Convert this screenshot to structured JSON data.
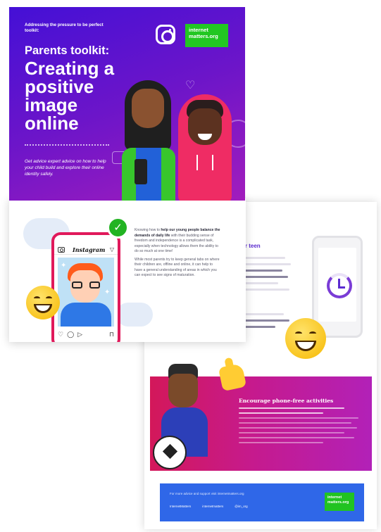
{
  "cover": {
    "kicker": "Addressing the pressure to be perfect toolkit:",
    "title_small": "Parents toolkit:",
    "title_big": "Creating a positive image online",
    "description": "Get advice expert advice on how to help your child build and explore their online identity safely.",
    "logo_text": "internet matters.org",
    "icons": [
      "instagram-icon",
      "heart-icon",
      "chat-icon"
    ]
  },
  "inner_page": {
    "app_name": "Instagram",
    "paragraph1_pre": "Knowing how to ",
    "paragraph1_bold": "help our young people balance the demands of daily life",
    "paragraph1_post": " with their budding sense of freedom and independence is a complicated task, especially when technology allows them the ability to do so much at one time!",
    "paragraph2": "While most parents try to keep general tabs on where their children are, offline and online, it can help to have a general understanding of areas in which you can expect to see signs of maturation.",
    "icons": [
      "check-icon",
      "camera-icon",
      "send-icon",
      "heart-icon",
      "comment-icon",
      "share-icon",
      "bookmark-icon"
    ]
  },
  "back_page": {
    "heading_fragment": "ur teen",
    "section_heading": "Encourage phone-free activities",
    "footer_text": "For more advice and support visit internetmatters.org",
    "social": [
      "InternetMatters",
      "internetmatters",
      "@im_org"
    ],
    "logo_text": "internet matters.org"
  },
  "colors": {
    "cover_gradient_start": "#4410d6",
    "cover_gradient_end": "#a21dbc",
    "brand_green": "#22c722",
    "accent_pink": "#e0195b",
    "footer_blue": "#2f67e8"
  }
}
